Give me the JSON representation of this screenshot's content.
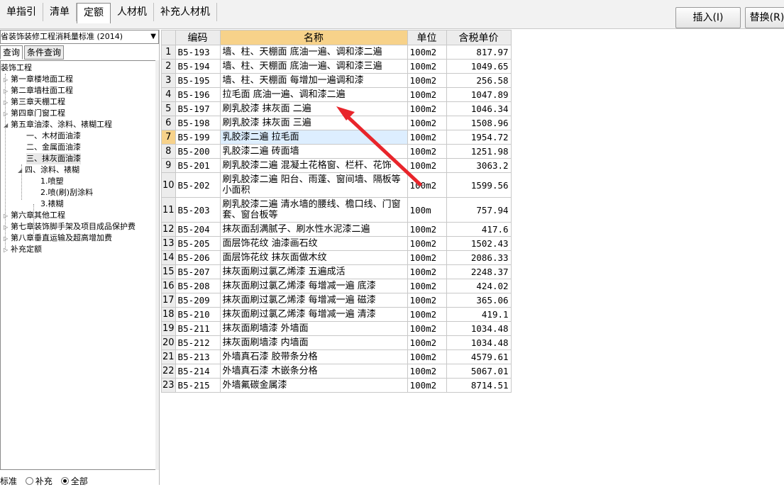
{
  "tabs": [
    {
      "label": "单指引",
      "active": false
    },
    {
      "label": "清单",
      "active": false
    },
    {
      "label": "定额",
      "active": true
    },
    {
      "label": "人材机",
      "active": false
    },
    {
      "label": "补充人材机",
      "active": false
    }
  ],
  "toolbar": {
    "insert_label": "插入(I)",
    "replace_label": "替换(R)"
  },
  "library_select": {
    "value": "省装饰装修工程消耗量标准 (2014)"
  },
  "query_tabs": {
    "standard": "查询",
    "condition": "条件查询"
  },
  "tree": [
    "装饰工程",
    "第一章楼地面工程",
    "第二章墙柱面工程",
    "第三章天棚工程",
    "第四章门窗工程",
    "第五章油漆、涂料、裱糊工程",
    "一、木材面油漆",
    "二、金属面油漆",
    "三、抹灰面油漆",
    "四、涂料、裱糊",
    "1.喷塑",
    "2.喷(刷)刮涂料",
    "3.裱糊",
    "第六章其他工程",
    "第七章装饰脚手架及项目成品保护费",
    "第八章垂直运输及超高增加费",
    "补充定额"
  ],
  "filter": {
    "standard": "标准",
    "supplement": "补充",
    "all": "全部",
    "selected": "all"
  },
  "grid": {
    "headers": {
      "code": "编码",
      "name": "名称",
      "unit": "单位",
      "price": "含税单价"
    },
    "selected_row": 7,
    "rows": [
      {
        "n": "1",
        "code": "B5-193",
        "name": "墙、柱、天棚面 底油一遍、调和漆二遍",
        "unit": "100m2",
        "price": "817.97"
      },
      {
        "n": "2",
        "code": "B5-194",
        "name": "墙、柱、天棚面 底油一遍、调和漆三遍",
        "unit": "100m2",
        "price": "1049.65"
      },
      {
        "n": "3",
        "code": "B5-195",
        "name": "墙、柱、天棚面 每增加一遍调和漆",
        "unit": "100m2",
        "price": "256.58"
      },
      {
        "n": "4",
        "code": "B5-196",
        "name": "拉毛面 底油一遍、调和漆二遍",
        "unit": "100m2",
        "price": "1047.89"
      },
      {
        "n": "5",
        "code": "B5-197",
        "name": "刷乳胶漆 抹灰面 二遍",
        "unit": "100m2",
        "price": "1046.34"
      },
      {
        "n": "6",
        "code": "B5-198",
        "name": "刷乳胶漆 抹灰面 三遍",
        "unit": "100m2",
        "price": "1508.96"
      },
      {
        "n": "7",
        "code": "B5-199",
        "name": "乳胶漆二遍 拉毛面",
        "unit": "100m2",
        "price": "1954.72"
      },
      {
        "n": "8",
        "code": "B5-200",
        "name": "乳胶漆二遍 砖面墙",
        "unit": "100m2",
        "price": "1251.98"
      },
      {
        "n": "9",
        "code": "B5-201",
        "name": "刷乳胶漆二遍 混凝土花格窗、栏杆、花饰",
        "unit": "100m2",
        "price": "3063.2"
      },
      {
        "n": "10",
        "code": "B5-202",
        "name": "刷乳胶漆二遍 阳台、雨蓬、窗间墙、隔板等小面积",
        "unit": "100m2",
        "price": "1599.56"
      },
      {
        "n": "11",
        "code": "B5-203",
        "name": "刷乳胶漆二遍 清水墙的腰线、檐口线、门窗套、窗台板等",
        "unit": "100m",
        "price": "757.94"
      },
      {
        "n": "12",
        "code": "B5-204",
        "name": "抹灰面刮满腻子、刷水性水泥漆二遍",
        "unit": "100m2",
        "price": "417.6"
      },
      {
        "n": "13",
        "code": "B5-205",
        "name": "面层饰花纹 油漆画石纹",
        "unit": "100m2",
        "price": "1502.43"
      },
      {
        "n": "14",
        "code": "B5-206",
        "name": "面层饰花纹 抹灰面做木纹",
        "unit": "100m2",
        "price": "2086.33"
      },
      {
        "n": "15",
        "code": "B5-207",
        "name": "抹灰面刷过氯乙烯漆 五遍成活",
        "unit": "100m2",
        "price": "2248.37"
      },
      {
        "n": "16",
        "code": "B5-208",
        "name": "抹灰面刷过氯乙烯漆 每增减一遍 底漆",
        "unit": "100m2",
        "price": "424.02"
      },
      {
        "n": "17",
        "code": "B5-209",
        "name": "抹灰面刷过氯乙烯漆 每增减一遍 磁漆",
        "unit": "100m2",
        "price": "365.06"
      },
      {
        "n": "18",
        "code": "B5-210",
        "name": "抹灰面刷过氯乙烯漆 每增减一遍 清漆",
        "unit": "100m2",
        "price": "419.1"
      },
      {
        "n": "19",
        "code": "B5-211",
        "name": "抹灰面刷墙漆 外墙面",
        "unit": "100m2",
        "price": "1034.48"
      },
      {
        "n": "20",
        "code": "B5-212",
        "name": "抹灰面刷墙漆 内墙面",
        "unit": "100m2",
        "price": "1034.48"
      },
      {
        "n": "21",
        "code": "B5-213",
        "name": "外墙真石漆 胶带条分格",
        "unit": "100m2",
        "price": "4579.61"
      },
      {
        "n": "22",
        "code": "B5-214",
        "name": "外墙真石漆 木嵌条分格",
        "unit": "100m2",
        "price": "5067.01"
      },
      {
        "n": "23",
        "code": "B5-215",
        "name": "外墙氟碳金属漆",
        "unit": "100m2",
        "price": "8714.51"
      }
    ]
  },
  "annotation": {
    "color": "#e8252b"
  }
}
